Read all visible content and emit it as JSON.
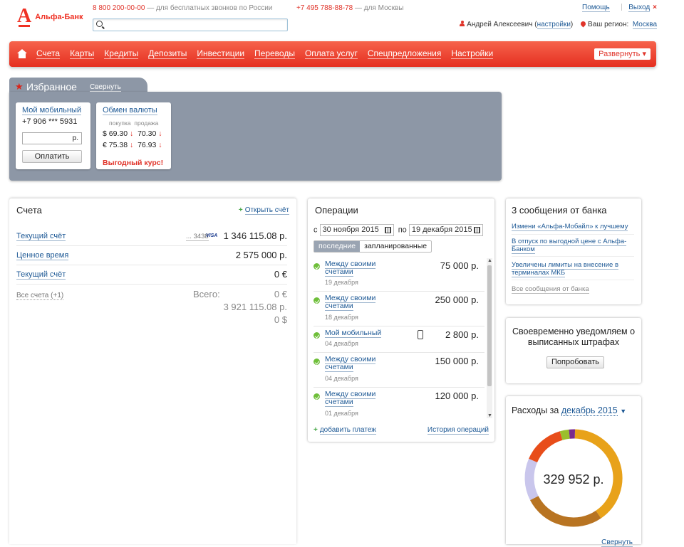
{
  "header": {
    "logo_text": "Альфа-Банк",
    "phone1": "8 800 200-00-00",
    "phone1_note": "— для бесплатных звонков по России",
    "phone2": "+7 495 788-88-78",
    "phone2_note": "— для Москвы",
    "search_placeholder": "",
    "help": "Помощь",
    "exit": "Выход",
    "user_name": "Андрей Алексеевич",
    "settings_link": "настройки",
    "region_label": "Ваш регион:",
    "region": "Москва"
  },
  "nav": {
    "items": [
      "Счета",
      "Карты",
      "Кредиты",
      "Депозиты",
      "Инвестиции",
      "Переводы",
      "Оплата услуг",
      "Спецпредложения",
      "Настройки"
    ],
    "expand": "Развернуть"
  },
  "favorites": {
    "title": "Избранное",
    "collapse": "Свернуть",
    "mobile": {
      "title": "Мой мобильный",
      "number": "+7 906 *** 5931",
      "currency": "р.",
      "pay": "Оплатить"
    },
    "fx": {
      "title": "Обмен валюты",
      "buy_label": "покупка",
      "sell_label": "продажа",
      "usd_symbol": "$",
      "usd_buy": "69.30",
      "usd_sell": "70.30",
      "eur_symbol": "€",
      "eur_buy": "75.38",
      "eur_sell": "76.93",
      "down_arrow": "↓",
      "best_rate": "Выгодный курс!"
    }
  },
  "accounts": {
    "title": "Счета",
    "open": "Открыть счёт",
    "rows": [
      {
        "name": "Текущий счёт",
        "card": "3438",
        "card_prefix": "...",
        "brand": "VISA",
        "value": "1 346 115.08 р."
      },
      {
        "name": "Ценное время",
        "value": "2 575 000 р."
      },
      {
        "name": "Текущий счёт",
        "value": "0 €"
      }
    ],
    "all": "Все счета (+1)",
    "total_label": "Всего:",
    "totals": [
      "0 €",
      "3 921 115.08 р.",
      "0 $"
    ]
  },
  "operations": {
    "title": "Операции",
    "from_label": "с",
    "from_date": "30 ноября 2015",
    "to_label": "по",
    "to_date": "19 декабря 2015",
    "tab_recent": "последние",
    "tab_planned": "запланированные",
    "items": [
      {
        "name": "Между своими счетами",
        "date": "19 декабря",
        "amount": "75 000 р."
      },
      {
        "name": "Между своими счетами",
        "date": "18 декабря",
        "amount": "250 000 р."
      },
      {
        "name": "Мой мобильный",
        "date": "04 декабря",
        "amount": "2 800 р."
      },
      {
        "name": "Между своими счетами",
        "date": "04 декабря",
        "amount": "150 000 р."
      },
      {
        "name": "Между своими счетами",
        "date": "01 декабря",
        "amount": "120 000 р."
      }
    ],
    "add_payment": "добавить платеж",
    "history": "История операций"
  },
  "messages": {
    "title": "3 сообщения от банка",
    "items": [
      "Измени «Альфа-Мобайл» к лучшему",
      "В отпуск по выгодной цене с Альфа-Банком",
      "Увеличены лимиты на внесение в терминалах МКБ"
    ],
    "all": "Все сообщения от банка"
  },
  "fines": {
    "text": "Своевременно уведомляем о выписанных штрафах",
    "button": "Попробовать"
  },
  "spending": {
    "title": "Расходы за",
    "period": "декабрь 2015",
    "total": "329 952 р.",
    "collapse": "Свернуть",
    "segments": [
      {
        "color": "#e8a21a",
        "value": 0.4
      },
      {
        "color": "#b87422",
        "value": 0.27
      },
      {
        "color": "#c9c6ec",
        "value": 0.14
      },
      {
        "color": "#e84d1a",
        "value": 0.14
      },
      {
        "color": "#9bbf2c",
        "value": 0.03
      },
      {
        "color": "#7a2a8e",
        "value": 0.02
      }
    ]
  }
}
